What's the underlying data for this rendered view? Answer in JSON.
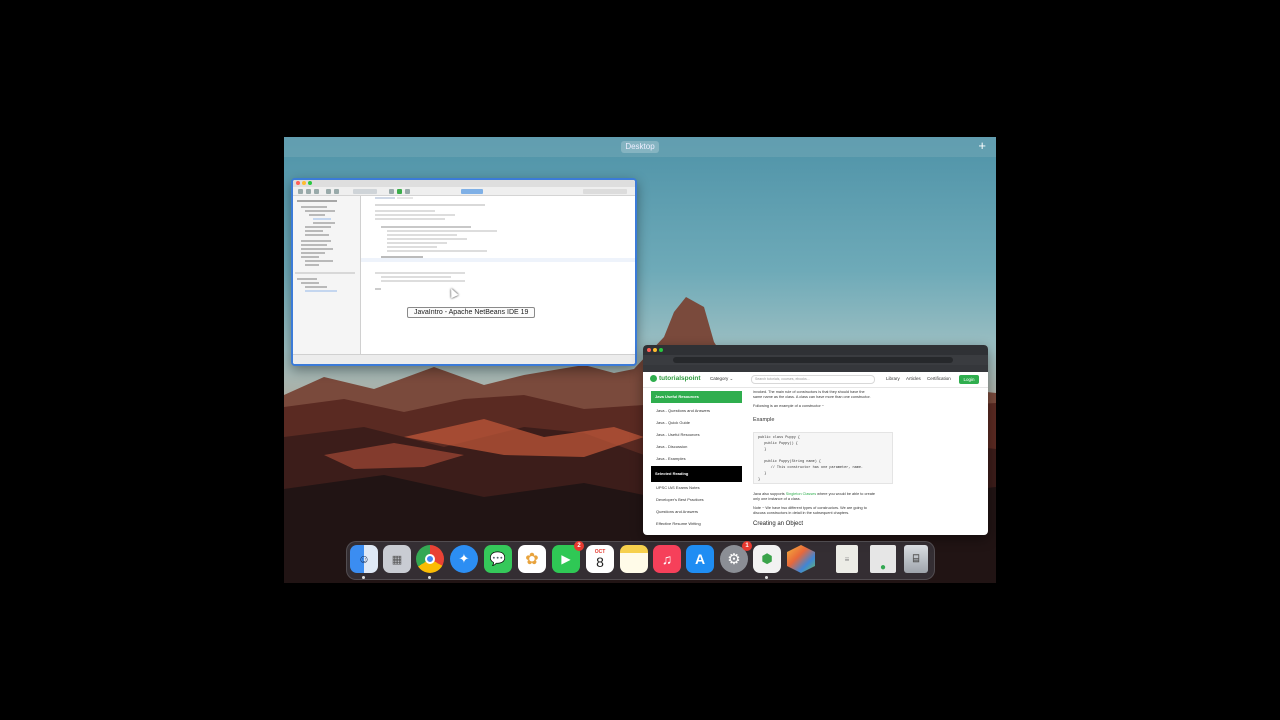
{
  "mission_control": {
    "desktop_label": "Desktop",
    "add_space_label": "+"
  },
  "netbeans_window": {
    "tooltip": "JavaIntro - Apache NetBeans IDE 19"
  },
  "browser_window": {
    "site_logo": "tutorialspoint",
    "category_label": "Category ⌄",
    "search_placeholder": "Search tutorials, courses, ebooks...",
    "nav": {
      "library": "Library",
      "articles": "Articles",
      "certification": "Certification",
      "login": "Login"
    },
    "sidebar": {
      "useful_heading": "Java Useful Resources",
      "useful_items": [
        "Java - Questions and Answers",
        "Java - Quick Guide",
        "Java - Useful Resources",
        "Java - Discussion",
        "Java - Examples"
      ],
      "reading_heading": "Selected Reading",
      "reading_items": [
        "UPSC IAS Exams Notes",
        "Developer's Best Practices",
        "Questions and Answers",
        "Effective Resume Writing"
      ]
    },
    "article": {
      "intro_1": "invoked. The main rule of constructors is that they should have the",
      "intro_2": "same name as the class. A class can have more than one constructor.",
      "following": "Following is an example of a constructor −",
      "example_heading": "Example",
      "code": [
        "public class Puppy {",
        "   public Puppy() {",
        "   }",
        "",
        "   public Puppy(String name) {",
        "      // This constructor has one parameter, name.",
        "   }",
        "}"
      ],
      "singleton_1": "Java also supports ",
      "singleton_link": "Singleton Classes",
      "singleton_2": " where you would be able to create",
      "singleton_3": "only one instance of a class.",
      "note_1": "Note − We have two different types of constructors. We are going to",
      "note_2": "discuss constructors in detail in the subsequent chapters.",
      "object_heading": "Creating an Object"
    }
  },
  "dock": {
    "calendar_month": "OCT",
    "calendar_day": "8",
    "facetime_badge": "2",
    "settings_badge": "1",
    "items": [
      "finder-icon",
      "launchpad-icon",
      "chrome-icon",
      "safari-icon",
      "messages-icon",
      "photos-icon",
      "facetime-icon",
      "calendar-icon",
      "notes-icon",
      "music-icon",
      "app-store-icon",
      "system-settings-icon",
      "app-icon",
      "netbeans-icon",
      "document-icon",
      "chrome-minimized-icon",
      "trash-icon"
    ]
  }
}
